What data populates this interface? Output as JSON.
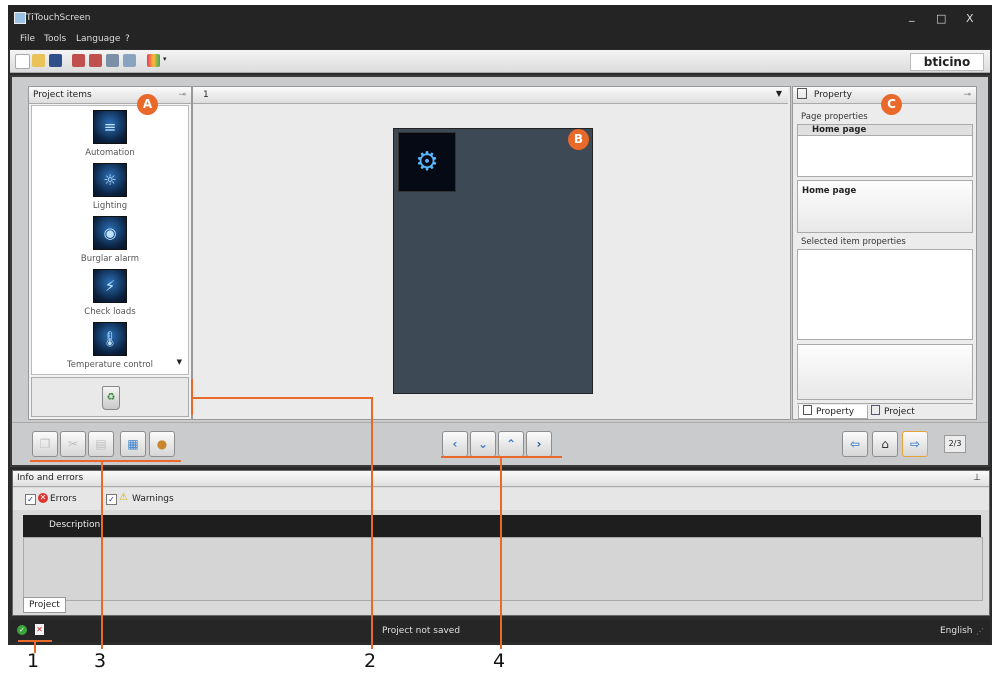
{
  "window": {
    "title": "TiTouchScreen",
    "controls": [
      "_",
      "□",
      "X"
    ]
  },
  "menu": [
    "File",
    "Tools",
    "Language",
    "?"
  ],
  "brand": {
    "logo_text": "bticino",
    "accent": "#e8692a"
  },
  "left_panel": {
    "title": "Project items",
    "items": [
      {
        "label": "Automation",
        "icon": "automation-icon"
      },
      {
        "label": "Lighting",
        "icon": "lighting-icon"
      },
      {
        "label": "Burglar alarm",
        "icon": "burglar-alarm-icon"
      },
      {
        "label": "Check loads",
        "icon": "check-loads-icon"
      },
      {
        "label": "Temperature control",
        "icon": "thermometer-icon"
      }
    ]
  },
  "center": {
    "page_selector_value": "1"
  },
  "right_panel": {
    "title": "Property",
    "page_properties_label": "Page properties",
    "page_grid_value": "Home page",
    "page_name": "Home page",
    "selected_item_label": "Selected item properties",
    "tabs": [
      "Property",
      "Project"
    ]
  },
  "bottom_bar": {
    "page_indicator": "2/3"
  },
  "info": {
    "title": "Info and errors",
    "errors_label": "Errors",
    "warnings_label": "Warnings",
    "grid_header": "Description",
    "tab": "Project"
  },
  "status_bar": {
    "message": "Project not saved",
    "language": "English"
  },
  "annotations": {
    "badges": [
      "A",
      "B",
      "C"
    ],
    "numbers": [
      "1",
      "2",
      "3",
      "4"
    ]
  }
}
